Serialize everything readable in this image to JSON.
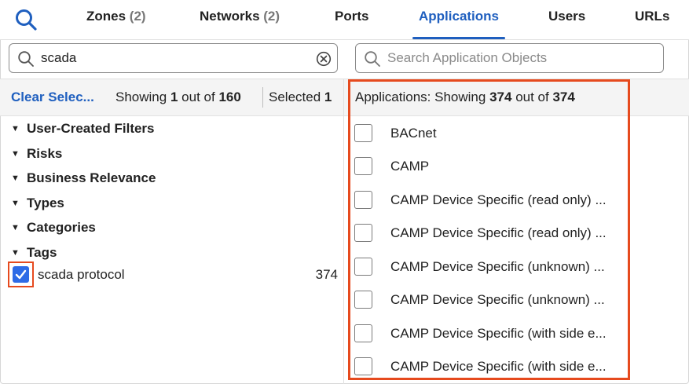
{
  "tabs": [
    {
      "label": "Zones",
      "count": "(2)"
    },
    {
      "label": "Networks",
      "count": "(2)"
    },
    {
      "label": "Ports",
      "count": ""
    },
    {
      "label": "Applications",
      "count": ""
    },
    {
      "label": "Users",
      "count": ""
    },
    {
      "label": "URLs",
      "count": ""
    }
  ],
  "active_tab": "Applications",
  "filter_search": {
    "value": "scada"
  },
  "app_search": {
    "placeholder": "Search Application Objects"
  },
  "left_header": {
    "clear_label": "Clear Selec...",
    "showing_prefix": "Showing",
    "showing_count": "1",
    "showing_mid": "out of",
    "showing_total": "160",
    "selected_label": "Selected",
    "selected_count": "1"
  },
  "filter_groups": [
    "User-Created Filters",
    "Risks",
    "Business Relevance",
    "Types",
    "Categories",
    "Tags"
  ],
  "tag_item": {
    "label": "scada protocol",
    "count": "374",
    "checked": true
  },
  "right_header": {
    "prefix": "Applications:",
    "showing": "Showing",
    "count": "374",
    "mid": "out of",
    "total": "374"
  },
  "applications": [
    "BACnet",
    "CAMP",
    "CAMP Device Specific (read only) ...",
    "CAMP Device Specific (read only) ...",
    "CAMP Device Specific (unknown) ...",
    "CAMP Device Specific (unknown) ...",
    "CAMP Device Specific (with side e...",
    "CAMP Device Specific (with side e..."
  ],
  "colors": {
    "accent": "#1f5fbf",
    "highlight": "#e64a1e",
    "checkbox": "#2e6be6"
  }
}
